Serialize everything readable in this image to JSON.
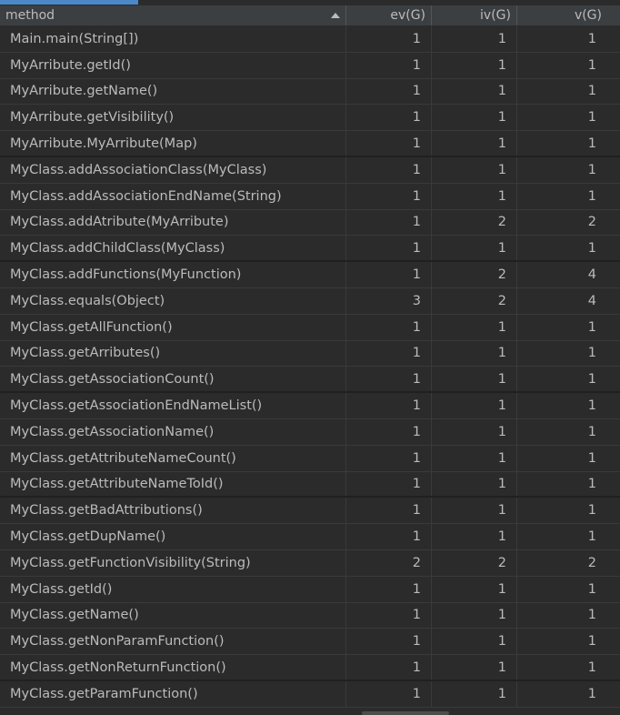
{
  "table": {
    "columns": {
      "method": "method",
      "ev": "ev(G)",
      "iv": "iv(G)",
      "v": "v(G)"
    },
    "sort": {
      "column": "method",
      "direction": "ascending",
      "icon": "sort-ascending-icon"
    },
    "rows": [
      {
        "method": "Main.main(String[])",
        "ev": "1",
        "iv": "1",
        "v": "1"
      },
      {
        "method": "MyArribute.getId()",
        "ev": "1",
        "iv": "1",
        "v": "1"
      },
      {
        "method": "MyArribute.getName()",
        "ev": "1",
        "iv": "1",
        "v": "1"
      },
      {
        "method": "MyArribute.getVisibility()",
        "ev": "1",
        "iv": "1",
        "v": "1"
      },
      {
        "method": "MyArribute.MyArribute(Map)",
        "ev": "1",
        "iv": "1",
        "v": "1"
      },
      {
        "method": "MyClass.addAssociationClass(MyClass)",
        "ev": "1",
        "iv": "1",
        "v": "1"
      },
      {
        "method": "MyClass.addAssociationEndName(String)",
        "ev": "1",
        "iv": "1",
        "v": "1"
      },
      {
        "method": "MyClass.addAtribute(MyArribute)",
        "ev": "1",
        "iv": "2",
        "v": "2"
      },
      {
        "method": "MyClass.addChildClass(MyClass)",
        "ev": "1",
        "iv": "1",
        "v": "1"
      },
      {
        "method": "MyClass.addFunctions(MyFunction)",
        "ev": "1",
        "iv": "2",
        "v": "4"
      },
      {
        "method": "MyClass.equals(Object)",
        "ev": "3",
        "iv": "2",
        "v": "4"
      },
      {
        "method": "MyClass.getAllFunction()",
        "ev": "1",
        "iv": "1",
        "v": "1"
      },
      {
        "method": "MyClass.getArributes()",
        "ev": "1",
        "iv": "1",
        "v": "1"
      },
      {
        "method": "MyClass.getAssociationCount()",
        "ev": "1",
        "iv": "1",
        "v": "1"
      },
      {
        "method": "MyClass.getAssociationEndNameList()",
        "ev": "1",
        "iv": "1",
        "v": "1"
      },
      {
        "method": "MyClass.getAssociationName()",
        "ev": "1",
        "iv": "1",
        "v": "1"
      },
      {
        "method": "MyClass.getAttributeNameCount()",
        "ev": "1",
        "iv": "1",
        "v": "1"
      },
      {
        "method": "MyClass.getAttributeNameToId()",
        "ev": "1",
        "iv": "1",
        "v": "1"
      },
      {
        "method": "MyClass.getBadAttributions()",
        "ev": "1",
        "iv": "1",
        "v": "1"
      },
      {
        "method": "MyClass.getDupName()",
        "ev": "1",
        "iv": "1",
        "v": "1"
      },
      {
        "method": "MyClass.getFunctionVisibility(String)",
        "ev": "2",
        "iv": "2",
        "v": "2"
      },
      {
        "method": "MyClass.getId()",
        "ev": "1",
        "iv": "1",
        "v": "1"
      },
      {
        "method": "MyClass.getName()",
        "ev": "1",
        "iv": "1",
        "v": "1"
      },
      {
        "method": "MyClass.getNonParamFunction()",
        "ev": "1",
        "iv": "1",
        "v": "1"
      },
      {
        "method": "MyClass.getNonReturnFunction()",
        "ev": "1",
        "iv": "1",
        "v": "1"
      },
      {
        "method": "MyClass.getParamFunction()",
        "ev": "1",
        "iv": "1",
        "v": "1"
      }
    ]
  },
  "colors": {
    "background": "#2b2b2b",
    "header": "#3c3f41",
    "text": "#bbbbbb",
    "accent": "#4a88c7"
  }
}
